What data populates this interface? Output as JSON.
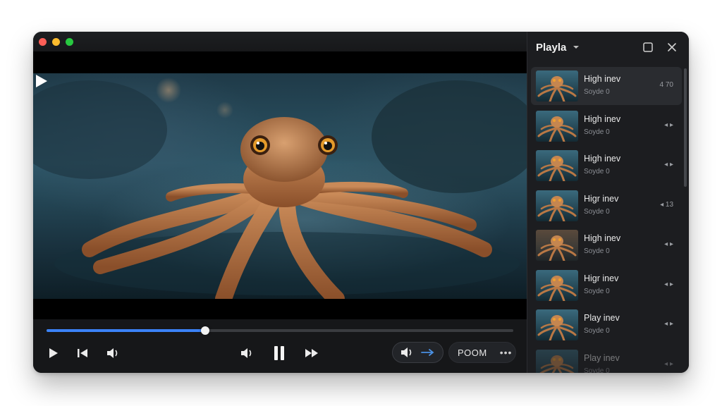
{
  "player": {
    "progress": 0.34
  },
  "controls": {
    "pill_label": "POOM"
  },
  "sidebar": {
    "title": "Playla",
    "items": [
      {
        "title": "High inev",
        "subtitle": "Soyde 0",
        "meta": "4 70",
        "active": true
      },
      {
        "title": "High inev",
        "subtitle": "Soyde 0",
        "meta": "◂ ▸"
      },
      {
        "title": "High inev",
        "subtitle": "Soyde 0",
        "meta": "◂ ▸"
      },
      {
        "title": "Higr inev",
        "subtitle": "Soyde 0",
        "meta": "◂ 13"
      },
      {
        "title": "High inev",
        "subtitle": "Soyde 0",
        "meta": "◂ ▸"
      },
      {
        "title": "Higr inev",
        "subtitle": "Soyde 0",
        "meta": "◂ ▸"
      },
      {
        "title": "Play inev",
        "subtitle": "Soyde 0",
        "meta": "◂ ▸"
      },
      {
        "title": "Play inev",
        "subtitle": "Soyde 0",
        "meta": "◂ ▸"
      }
    ]
  }
}
